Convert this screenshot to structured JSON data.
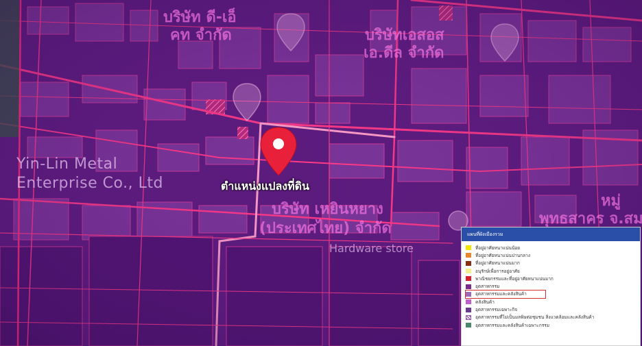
{
  "map": {
    "labels": {
      "company_top_th_line1": "บริษัท ดี-เอ็",
      "company_top_th_line2": "คท จำกัด",
      "company_mid_th_line1": "บริษัทเอสอส",
      "company_mid_th_line2": "เอ.ดีล จำกัด",
      "yinlin_line1": "Yin-Lin Metal",
      "yinlin_line2": "Enterprise Co., Ltd",
      "plot_location": "ตำแหน่งแปลงที่ดิน",
      "company_bottom_th_line1": "บริษัท เหยินหยาง",
      "company_bottom_th_line2": "(ประเทศไทย) จำกัด",
      "hardware_store": "Hardware store",
      "right_edge_line1": "หมู่",
      "right_edge_line2": "พุทธสาคร จ.สม"
    },
    "colors": {
      "base": "#5a1a7a",
      "roads": "#ff2d7a",
      "pin": "#e8203a"
    },
    "icons": [
      "location-pin-icon",
      "map-marker-icon"
    ]
  },
  "legend": {
    "title": "แผนที่ผังเมืองรวม",
    "items": [
      {
        "label": "ที่อยู่อาศัยหนาแน่นน้อย",
        "color": "#f2e600"
      },
      {
        "label": "ที่อยู่อาศัยหนาแน่นปานกลาง",
        "color": "#e8882a"
      },
      {
        "label": "ที่อยู่อาศัยหนาแน่นมาก",
        "color": "#8b2e10"
      },
      {
        "label": "อนุรักษ์เพื่อการอยู่อาศัย",
        "color": "#f5f08a"
      },
      {
        "label": "พาณิชยกรรมและที่อยู่อาศัยหนาแน่นมาก",
        "color": "#d8202a"
      },
      {
        "label": "อุตสาหกรรม",
        "color": "#7a2a8a"
      },
      {
        "label": "อุตสาหกรรมและคลังสินค้า",
        "color": "#9a6ab8",
        "highlighted": true
      },
      {
        "label": "คลังสินค้า",
        "color": "#c060d0"
      },
      {
        "label": "อุตสาหกรรมเฉพาะกิจ",
        "color": "#6a3a90"
      },
      {
        "label": "อุตสาหกรรมที่ไม่เป็นมลพิษต่อชุมชน สิ่งแวดล้อมและคลังสินค้า",
        "color": "#9b59b6",
        "hatch": true
      },
      {
        "label": "อุตสาหกรรมและคลังสินค้าเฉพาะกรรม",
        "color": "#4a8a6a"
      }
    ]
  }
}
